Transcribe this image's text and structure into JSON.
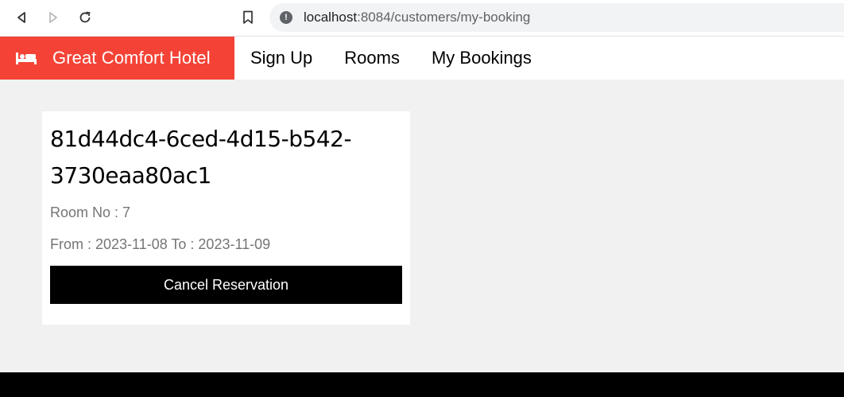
{
  "browser": {
    "url_host": "localhost",
    "url_rest": ":8084/customers/my-booking",
    "icons": [
      "back-icon",
      "forward-icon",
      "reload-icon",
      "bookmark-icon",
      "site-info-icon"
    ]
  },
  "navbar": {
    "brand_name": "Great Comfort Hotel",
    "brand_icon": "bed-icon",
    "links": [
      "Sign Up",
      "Rooms",
      "My Bookings"
    ]
  },
  "booking": {
    "id_line1": "81d44dc4-6ced-4d15-b542-",
    "id_line2": "3730eaa80ac1",
    "room_text": "Room No : 7",
    "dates_text": "From : 2023-11-08 To : 2023-11-09",
    "cancel_label": "Cancel Reservation"
  },
  "colors": {
    "brand": "#f44336",
    "background": "#f1f1f1",
    "button": "#000000"
  }
}
